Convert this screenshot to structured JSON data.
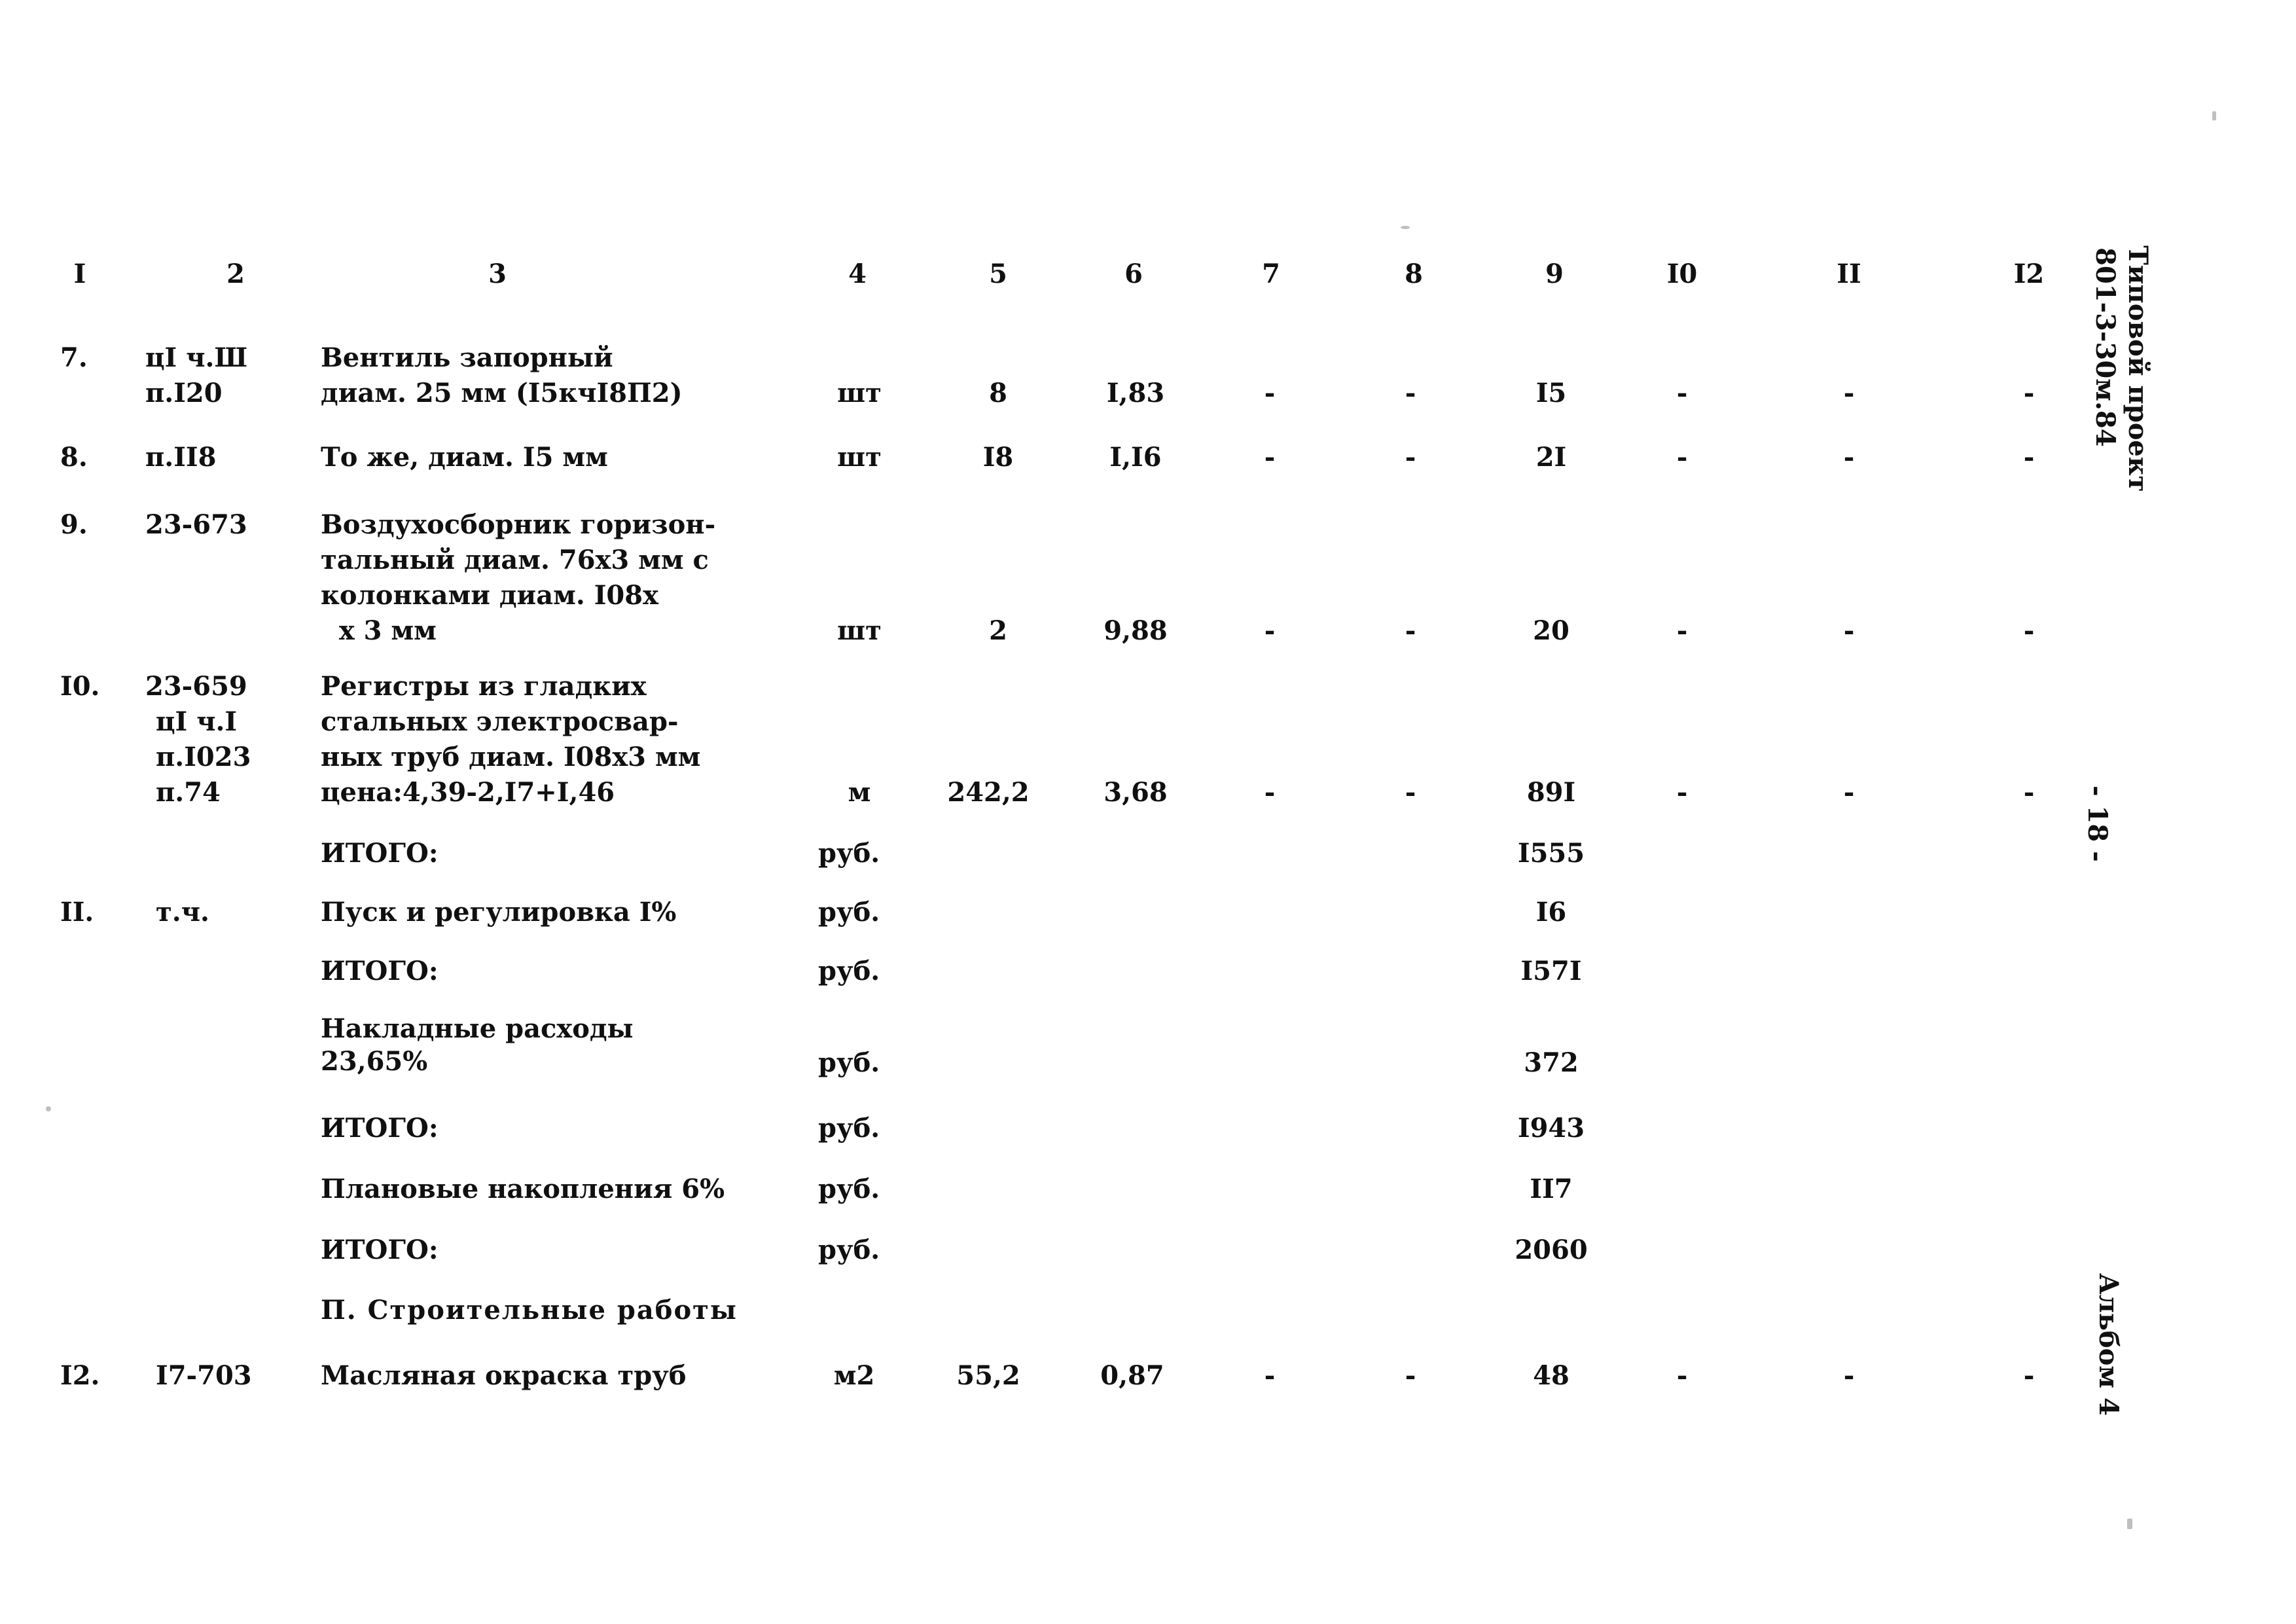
{
  "document": {
    "type": "construction-cost-estimate",
    "language": "ru",
    "project_label": "Типовой проект",
    "project_code": "801-3-30м.84",
    "page_marker": "- 18 -",
    "album_label": "Альбом 4"
  },
  "table": {
    "column_headers": [
      "I",
      "2",
      "3",
      "4",
      "5",
      "6",
      "7",
      "8",
      "9",
      "I0",
      "II",
      "I2"
    ],
    "rows": [
      {
        "no": "7.",
        "code_lines": [
          "цI ч.Ш",
          "п.I20"
        ],
        "desc_lines": [
          "Вентиль запорный",
          "диам. 25 мм (I5кчI8П2)"
        ],
        "unit": "шт",
        "qty": "8",
        "price": "I,83",
        "c7": "-",
        "c8": "-",
        "total": "I5",
        "c10": "-",
        "c11": "-",
        "c12": "-"
      },
      {
        "no": "8.",
        "code_lines": [
          "п.II8"
        ],
        "desc_lines": [
          "То же, диам. I5 мм"
        ],
        "unit": "шт",
        "qty": "I8",
        "price": "I,I6",
        "c7": "-",
        "c8": "-",
        "total": "2I",
        "c10": "-",
        "c11": "-",
        "c12": "-"
      },
      {
        "no": "9.",
        "code_lines": [
          "23-673"
        ],
        "desc_lines": [
          "Воздухосборник горизон-",
          "тальный диам. 76х3 мм с",
          "колонками диам. I08х",
          "  х 3 мм"
        ],
        "unit": "шт",
        "qty": "2",
        "price": "9,88",
        "c7": "-",
        "c8": "-",
        "total": "20",
        "c10": "-",
        "c11": "-",
        "c12": "-"
      },
      {
        "no": "I0.",
        "code_lines": [
          "23-659",
          "цI ч.I",
          "п.I023",
          "п.74"
        ],
        "desc_lines": [
          "Регистры из гладких",
          "стальных электросвар-",
          "ных труб диам. I08х3 мм",
          "цена:4,39-2,I7+I,46"
        ],
        "unit": "м",
        "qty": "242,2",
        "price": "3,68",
        "c7": "-",
        "c8": "-",
        "total": "89I",
        "c10": "-",
        "c11": "-",
        "c12": "-"
      }
    ],
    "summary_rows": [
      {
        "no": "",
        "code": "",
        "label": "ИТОГО:",
        "unit": "руб.",
        "total": "I555"
      },
      {
        "no": "II.",
        "code": "т.ч.",
        "label": "Пуск и регулировка I%",
        "unit": "руб.",
        "total": "I6"
      },
      {
        "no": "",
        "code": "",
        "label": "ИТОГО:",
        "unit": "руб.",
        "total": "I57I"
      },
      {
        "no": "",
        "code": "",
        "label": "Накладные расходы\n23,65%",
        "unit": "руб.",
        "total": "372"
      },
      {
        "no": "",
        "code": "",
        "label": "ИТОГО:",
        "unit": "руб.",
        "total": "I943"
      },
      {
        "no": "",
        "code": "",
        "label": "Плановые накопления 6%",
        "unit": "руб.",
        "total": "II7"
      },
      {
        "no": "",
        "code": "",
        "label": "ИТОГО:",
        "unit": "руб.",
        "total": "2060"
      }
    ],
    "section_heading": "П. Строительные работы",
    "last_row": {
      "no": "I2.",
      "code": "I7-703",
      "desc": "Масляная окраска труб",
      "unit": "м2",
      "qty": "55,2",
      "price": "0,87",
      "c7": "-",
      "c8": "-",
      "total": "48",
      "c10": "-",
      "c11": "-",
      "c12": "-"
    }
  }
}
